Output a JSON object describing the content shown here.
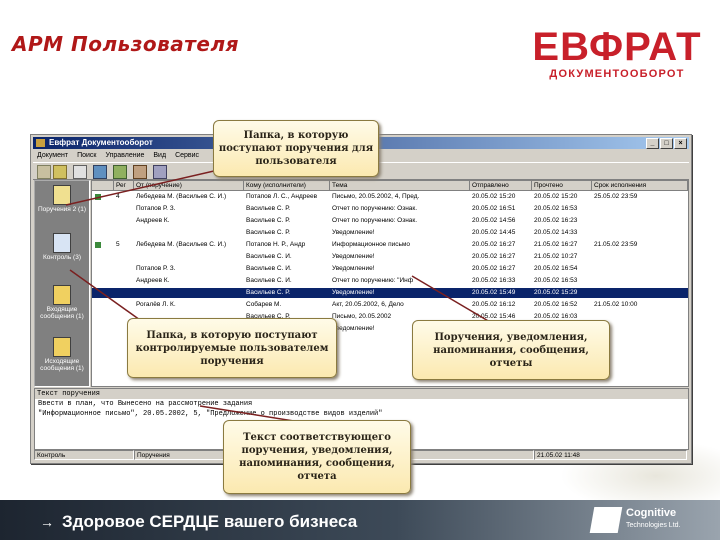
{
  "slide": {
    "title": "АРМ Пользователя",
    "slogan": "Здоровое СЕРДЦЕ вашего бизнеса",
    "slogan_arrow": "→"
  },
  "logo": {
    "big": "ЕВФРАТ",
    "small": "ДОКУМЕНТООБОРОТ"
  },
  "company": {
    "name": "Cognitive",
    "sub": "Technologies Ltd."
  },
  "window": {
    "title": "Евфрат Документооборот",
    "menu": [
      "Документ",
      "Поиск",
      "Управление",
      "Вид",
      "Сервис"
    ],
    "controls": {
      "minimize": "_",
      "maximize": "□",
      "close": "×"
    }
  },
  "sidebar": [
    {
      "label": "Поручения 2 (1)"
    },
    {
      "label": "Контроль (3)"
    },
    {
      "label": "Входящие сообщения (1)"
    },
    {
      "label": "Исходящие сообщения (1)"
    }
  ],
  "grid": {
    "columns": [
      "",
      "Рег",
      "От (поручение)",
      "Кому (исполнители)",
      "Тема",
      "Отправлено",
      "Прочтено",
      "Срок исполнения"
    ],
    "rows": [
      {
        "n": "4",
        "from": "Лебедева М. (Васильев С. И.)",
        "to": "Потапов Л. С., Андреев",
        "subject": "Письмо, 20.05.2002, 4, Пред.",
        "sent": "20.05.02 15:20",
        "read": "20.05.02 15:20",
        "due": "25.05.02 23:59"
      },
      {
        "n": "",
        "from": "Потапов Р. З.",
        "to": "Васильев С. Р.",
        "subject": "Отчет по поручению: Ознак.",
        "sent": "20.05.02 16:51",
        "read": "20.05.02 16:53",
        "due": ""
      },
      {
        "n": "",
        "from": "Андреев К.",
        "to": "Васильев С. Р.",
        "subject": "Отчет по поручению: Ознак.",
        "sent": "20.05.02 14:56",
        "read": "20.05.02 16:23",
        "due": ""
      },
      {
        "n": "",
        "from": "",
        "to": "Васильев С. Р.",
        "subject": "Уведомление!",
        "sent": "20.05.02 14:45",
        "read": "20.05.02 14:33",
        "due": ""
      },
      {
        "n": "5",
        "from": "Лебедева М. (Васильев С. И.)",
        "to": "Потапов Н. Р., Андр",
        "subject": "Информационное письмо",
        "sent": "20.05.02 16:27",
        "read": "21.05.02 16:27",
        "due": "21.05.02 23:59"
      },
      {
        "n": "",
        "from": "",
        "to": "Васильев С. И.",
        "subject": "Уведомление!",
        "sent": "20.05.02 16:27",
        "read": "21.05.02 10:27",
        "due": ""
      },
      {
        "n": "",
        "from": "Потапов Р. З.",
        "to": "Васильев С. И.",
        "subject": "Уведомление!",
        "sent": "20.05.02 16:27",
        "read": "20.05.02 16:54",
        "due": ""
      },
      {
        "n": "",
        "from": "Андреев К.",
        "to": "Васильев С. И.",
        "subject": "Отчет по поручению: \"Инф",
        "sent": "20.05.02 16:33",
        "read": "20.05.02 16:53",
        "due": ""
      },
      {
        "n": "",
        "from": "",
        "to": "Васильев С. Р.",
        "subject": "Уведомление!",
        "sent": "20.05.02 15:49",
        "read": "20.05.02 15:29",
        "due": ""
      },
      {
        "n": "",
        "from": "Рогалёв Л. К.",
        "to": "Собарев М.",
        "subject": "Акт, 20.05.2002, 6, Дело",
        "sent": "20.05.02 16:12",
        "read": "20.05.02 16:52",
        "due": "21.05.02 10:00"
      },
      {
        "n": "",
        "from": "",
        "to": "Васильев С. Р.",
        "subject": "Письмо, 20.05.2002",
        "sent": "20.05.02 15:46",
        "read": "20.05.02 16:03",
        "due": ""
      },
      {
        "n": "",
        "from": "",
        "to": "Васильев С. Р.",
        "subject": "Уведомление!",
        "sent": "20.05.02 15:40",
        "read": "20.05.02 16:10",
        "due": ""
      }
    ]
  },
  "text_panel": {
    "header": "Текст поручения",
    "lines": [
      "Ввести в план, что Вынесено на рассмотрение задания",
      "\"Информационное письмо\", 20.05.2002, 5, \"Предложение о производстве видов изделий\""
    ]
  },
  "status": [
    "Контроль",
    "Поручения",
    "Лебедева М. (Васильев С. И.)",
    "21.05.02 11:48"
  ],
  "callouts": {
    "folder": "Папка, в которую поступают поручения для пользователя",
    "control": "Папка, в которую поступают контролируемые пользователем поручения",
    "messages": "Поручения, уведомления, напоминания, сообщения, отчеты",
    "text": "Текст соответствующего поручения, уведомления, напоминания, сообщения, отчета"
  },
  "colors": {
    "title": "#b01818",
    "logo": "#c8202a",
    "selection": "#0a246a",
    "callout": "#fbe9b0"
  }
}
